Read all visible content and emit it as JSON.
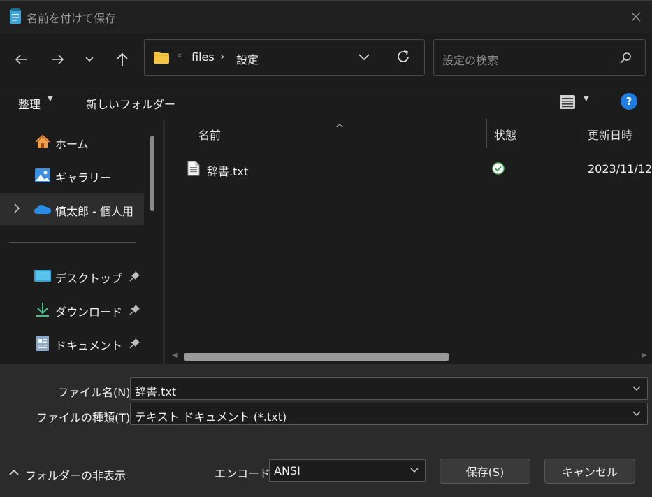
{
  "window": {
    "title": "名前を付けて保存",
    "icon": "notepad-icon"
  },
  "address": {
    "overflow": "«",
    "crumbs": [
      "files",
      "設定"
    ]
  },
  "search": {
    "placeholder": "設定の検索"
  },
  "toolbar": {
    "organize": "整理",
    "new_folder": "新しいフォルダー",
    "help": "?"
  },
  "sidebar": {
    "items": [
      {
        "label": "ホーム",
        "icon": "home-icon"
      },
      {
        "label": "ギャラリー",
        "icon": "gallery-icon"
      },
      {
        "label": "慎太郎 - 個人用",
        "icon": "onedrive-cloud-icon"
      },
      {
        "label": "デスクトップ",
        "icon": "desktop-icon"
      },
      {
        "label": "ダウンロード",
        "icon": "download-icon"
      },
      {
        "label": "ドキュメント",
        "icon": "documents-icon"
      }
    ]
  },
  "columns": {
    "name": "名前",
    "status": "状態",
    "modified": "更新日時"
  },
  "files": [
    {
      "name": "辞書.txt",
      "status": "synced-check-icon",
      "modified": "2023/11/12"
    }
  ],
  "form": {
    "filename_label": "ファイル名(N):",
    "filename_value": "辞書.txt",
    "filetype_label": "ファイルの種類(T):",
    "filetype_value": "テキスト ドキュメント (*.txt)",
    "encoding_label": "エンコード:",
    "encoding_value": "ANSI",
    "save": "保存(S)",
    "cancel": "キャンセル",
    "hide_folders": "フォルダーの非表示"
  },
  "colors": {
    "accent": "#1e7de0",
    "folder": "#f4c542",
    "check": "#5fbf6a"
  }
}
